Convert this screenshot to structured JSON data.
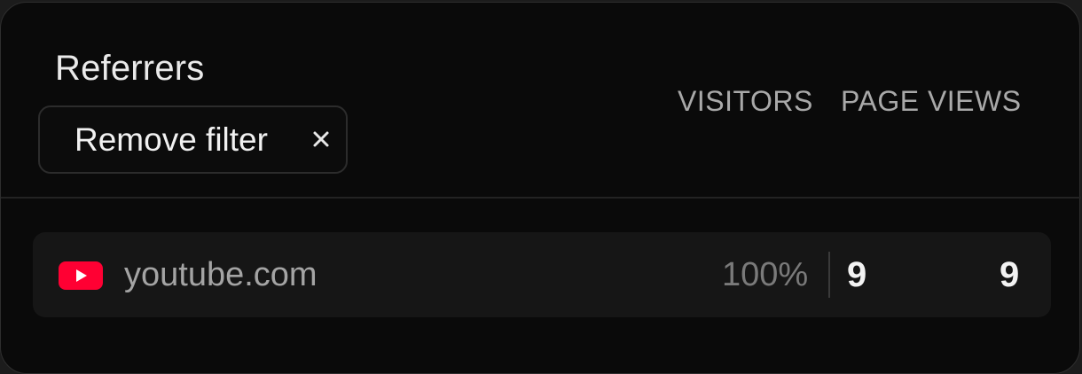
{
  "panel": {
    "title": "Referrers",
    "filter_chip": {
      "label": "Remove filter",
      "icon": "close-icon"
    },
    "columns": [
      "VISITORS",
      "PAGE VIEWS"
    ]
  },
  "rows": [
    {
      "icon": "youtube-icon",
      "name": "youtube.com",
      "percent": "100%",
      "visitors": "9",
      "page_views": "9"
    }
  ],
  "colors": {
    "background": "#0a0a0a",
    "row_background": "#161616",
    "youtube_red": "#ff0033"
  }
}
